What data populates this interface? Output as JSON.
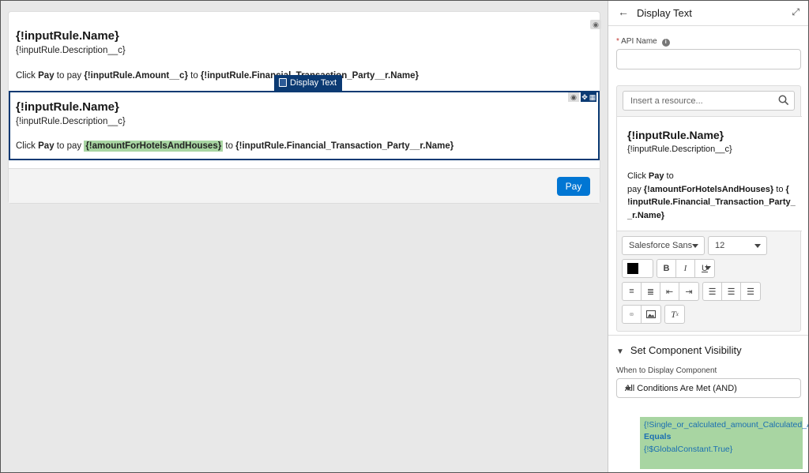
{
  "canvas": {
    "block1": {
      "title": "{!inputRule.Name}",
      "description": "{!inputRule.Description__c}",
      "pay_prefix": "Click ",
      "pay_word": "Pay",
      "pay_mid": " to pay ",
      "amount": "{!inputRule.Amount__c}",
      "to": " to ",
      "party": "{!inputRule.Financial_Transaction_Party__r.Name}"
    },
    "tag_label": "Display Text",
    "block2": {
      "title": "{!inputRule.Name}",
      "description": "{!inputRule.Description__c}",
      "pay_prefix": "Click ",
      "pay_word": "Pay",
      "pay_mid": " to pay ",
      "amount": "{!amountForHotelsAndHouses}",
      "to": " to ",
      "party": "{!inputRule.Financial_Transaction_Party__r.Name}"
    },
    "pay_button": "Pay"
  },
  "panel": {
    "title": "Display Text",
    "api_name_label": "API Name",
    "api_name_value": "",
    "resource_placeholder": "Insert a resource...",
    "editor": {
      "title": "{!inputRule.Name}",
      "description": "{!inputRule.Description__c}",
      "line1_prefix": "Click ",
      "line1_bold": "Pay",
      "line1_suffix": " to",
      "line2_prefix": "pay ",
      "line2_bold": "{!amountForHotelsAndHouses}",
      "line2_mid": " to ",
      "line2_bold2": "{",
      "line3": "!inputRule.Financial_Transaction_Party_",
      "line4": "_r.Name}"
    },
    "font_family": "Salesforce Sans",
    "font_size": "12",
    "text_color": "#000000",
    "visibility": {
      "heading": "Set Component Visibility",
      "when_label": "When to Display Component",
      "when_value": "All Conditions Are Met (AND)",
      "condition": {
        "field": "{!Single_or_calculated_amount_Calculated_Amount}",
        "operator": "Equals",
        "value": "{!$GlobalConstant.True}"
      }
    }
  },
  "colors": {
    "accent": "#0176d3",
    "selection": "#0b3a73",
    "highlight": "#a8d5a2"
  }
}
